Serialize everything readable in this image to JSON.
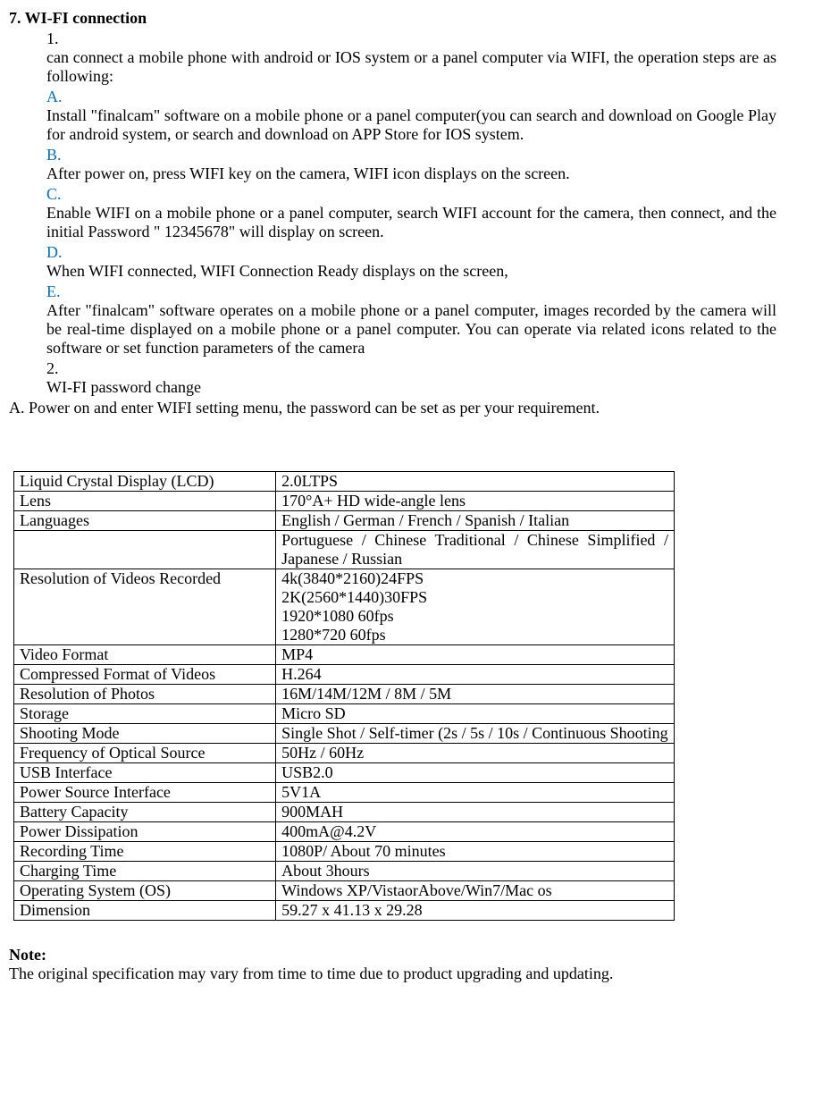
{
  "title": "7. WI-FI connection",
  "items": {
    "i1": {
      "marker": "1.",
      "text1": "can connect a mobile phone with android or IOS system or a panel computer via WIFI, the operation steps are as following:"
    },
    "iA": {
      "marker": "A.",
      "text": "Install \"finalcam\" software on a mobile phone or a panel computer(you can search and download on Google Play for android system, or search and download on APP Store for IOS system."
    },
    "iB": {
      "marker": "B.",
      "text": "After power on, press WIFI key on the camera, WIFI icon displays on the screen."
    },
    "iC": {
      "marker": "C.",
      "text": "Enable WIFI on a mobile phone or a panel computer, search WIFI account    for the camera, then connect, and the initial Password \" 12345678\" will display on screen."
    },
    "iD": {
      "marker": "D.",
      "text": "When WIFI connected, WIFI Connection Ready displays on the screen,"
    },
    "iE": {
      "marker": "E.",
      "text": "After \"finalcam\" software operates on a mobile phone or a panel computer, images recorded by the camera will be real-time displayed on a mobile phone or a panel computer. You can operate via related icons related to the software or set function parameters of the camera"
    },
    "i2": {
      "marker": "2.",
      "text": "WI-FI password change"
    }
  },
  "paraA": "A. Power on and enter WIFI setting menu, the password can be set as per your requirement.",
  "specs": {
    "r0": {
      "label": "Liquid Crystal Display (LCD)",
      "value": "2.0LTPS"
    },
    "r1": {
      "label": "Lens",
      "value": "170°A+ HD wide-angle lens"
    },
    "r2": {
      "label": "Languages",
      "value": "English / German / French / Spanish / Italian"
    },
    "r3": {
      "label": "",
      "value": "Portuguese / Chinese Traditional / Chinese Simplified / Japanese / Russian"
    },
    "r4": {
      "label": "Resolution of Videos Recorded",
      "value": "4k(3840*2160)24FPS\n2K(2560*1440)30FPS\n1920*1080 60fps\n1280*720 60fps"
    },
    "r5": {
      "label": "Video Format",
      "value": "MP4"
    },
    "r6": {
      "label": "Compressed Format of Videos",
      "value": "H.264"
    },
    "r7": {
      "label": "Resolution of Photos",
      "value": "16M/14M/12M / 8M / 5M"
    },
    "r8": {
      "label": "Storage",
      "value": "Micro SD"
    },
    "r9": {
      "label": "Shooting Mode",
      "value": "Single Shot / Self-timer (2s / 5s / 10s / Continuous Shooting"
    },
    "r10": {
      "label": "Frequency of Optical Source",
      "value": "50Hz / 60Hz"
    },
    "r11": {
      "label": "USB Interface",
      "value": "USB2.0"
    },
    "r12": {
      "label": "Power Source Interface",
      "value": "5V1A"
    },
    "r13": {
      "label": "Battery Capacity",
      "value": "900MAH"
    },
    "r14": {
      "label": "Power Dissipation",
      "value": "400mA@4.2V"
    },
    "r15": {
      "label": "Recording Time",
      "value": "1080P/ About 70 minutes"
    },
    "r16": {
      "label": "Charging Time",
      "value": "About 3hours"
    },
    "r17": {
      "label": "Operating System (OS)",
      "value": "Windows XP/VistaorAbove/Win7/Mac os"
    },
    "r18": {
      "label": "Dimension",
      "value": "59.27 x 41.13 x 29.28"
    }
  },
  "note": {
    "title": "Note:",
    "text": "The original specification may vary from time to time due to product upgrading and updating."
  }
}
